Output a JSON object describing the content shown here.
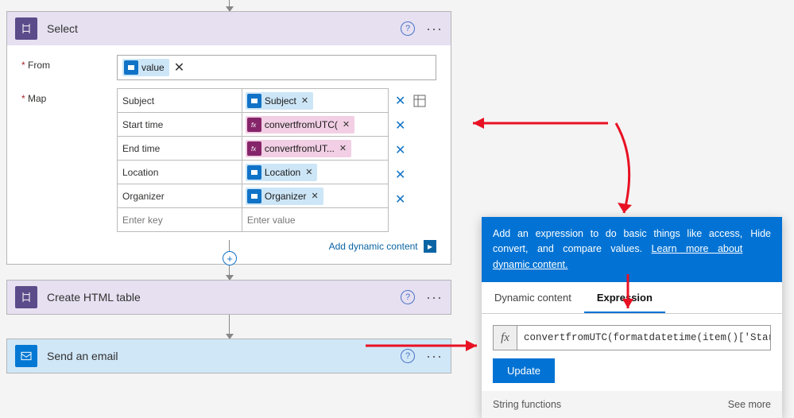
{
  "select": {
    "title": "Select",
    "from_label": "From",
    "map_label": "Map",
    "from_token": "value",
    "rows": [
      {
        "key": "Subject",
        "token": "Subject",
        "style": "blue"
      },
      {
        "key": "Start time",
        "token": "convertfromUTC(",
        "style": "pink"
      },
      {
        "key": "End time",
        "token": "convertfromUT...",
        "style": "pink"
      },
      {
        "key": "Location",
        "token": "Location",
        "style": "blue"
      },
      {
        "key": "Organizer",
        "token": "Organizer",
        "style": "blue"
      }
    ],
    "placeholder_key": "Enter key",
    "placeholder_value": "Enter value",
    "add_dynamic": "Add dynamic content"
  },
  "htmlTable": {
    "title": "Create HTML table"
  },
  "email": {
    "title": "Send an email"
  },
  "panel": {
    "intro": "Add an expression to do basic things like access, convert, and compare values.",
    "learn": "Learn more about dynamic content.",
    "hide": "Hide",
    "tab_dynamic": "Dynamic content",
    "tab_expression": "Expression",
    "fx": "fx",
    "expression": "convertfromUTC(formatdatetime(item()['Star",
    "update": "Update",
    "funcs_label": "String functions",
    "see_more": "See more"
  }
}
